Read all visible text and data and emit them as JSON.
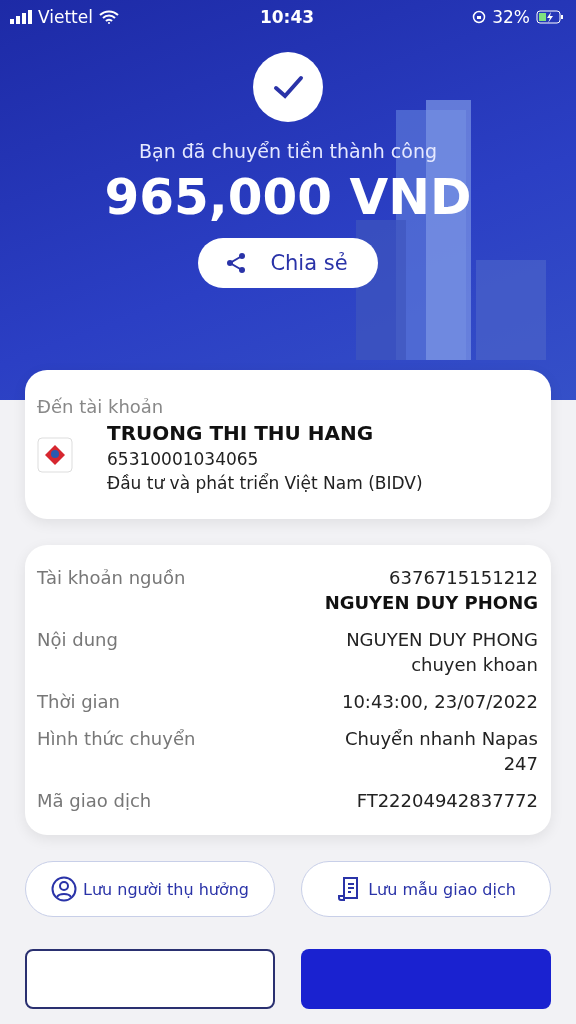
{
  "status_bar": {
    "carrier": "Viettel",
    "time": "10:43",
    "battery": "32%"
  },
  "hero": {
    "message": "Bạn đã chuyển tiền thành công",
    "amount": "965,000 VND",
    "share_button": "Chia sẻ"
  },
  "recipient": {
    "label": "Đến tài khoản",
    "name": "TRUONG THI THU HANG",
    "account": "65310001034065",
    "bank": "Đầu tư và phát triển Việt Nam (BIDV)"
  },
  "details": [
    {
      "label": "Tài khoản nguồn",
      "values": [
        "6376715151212",
        "NGUYEN DUY PHONG"
      ],
      "bold_last": true
    },
    {
      "label": "Nội dung",
      "values": [
        "NGUYEN DUY PHONG",
        "chuyen khoan"
      ],
      "bold_last": false
    },
    {
      "label": "Thời gian",
      "values": [
        "10:43:00, 23/07/2022"
      ],
      "bold_last": false
    },
    {
      "label": "Hình thức chuyển",
      "values": [
        "Chuyển nhanh Napas",
        "247"
      ],
      "bold_last": false
    },
    {
      "label": "Mã giao dịch",
      "values": [
        "FT22204942837772"
      ],
      "bold_last": false
    }
  ],
  "actions": [
    {
      "label": "Lưu người thụ hưởng",
      "kind": "person"
    },
    {
      "label": "Lưu mẫu giao dịch",
      "kind": "document"
    }
  ]
}
